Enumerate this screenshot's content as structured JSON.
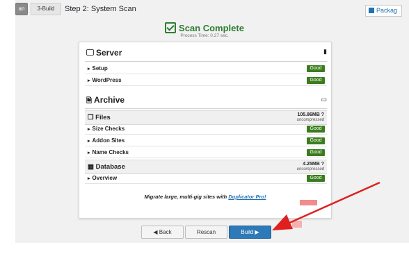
{
  "tabs": {
    "prev_partial": "an",
    "build_tab": "3-Build"
  },
  "step_title": "Step 2: System Scan",
  "packages_button": "Packag",
  "scan": {
    "title": "Scan Complete",
    "process_time": "Process Time: 0.27 sec."
  },
  "server": {
    "heading": "Server",
    "rows": [
      {
        "label": "Setup",
        "status": "Good"
      },
      {
        "label": "WordPress",
        "status": "Good"
      }
    ]
  },
  "archive": {
    "heading": "Archive",
    "files": {
      "heading": "Files",
      "size": "105.86MB",
      "note": "uncompressed",
      "rows": [
        {
          "label": "Size Checks",
          "status": "Good"
        },
        {
          "label": "Addon Sites",
          "status": "Good"
        },
        {
          "label": "Name Checks",
          "status": "Good"
        }
      ]
    },
    "database": {
      "heading": "Database",
      "size": "4.25MB",
      "note": "uncompressed",
      "rows": [
        {
          "label": "Overview",
          "status": "Good"
        }
      ]
    }
  },
  "promo": {
    "text": "Migrate large, multi-gig sites with",
    "link": "Duplicator Pro!"
  },
  "buttons": {
    "back": "◀ Back",
    "rescan": "Rescan",
    "build": "Build ▶"
  },
  "colors": {
    "good": "#3a7d1e",
    "success": "#2e7d32",
    "primary": "#2e7ab8",
    "annotation_arrow": "#e02020"
  }
}
